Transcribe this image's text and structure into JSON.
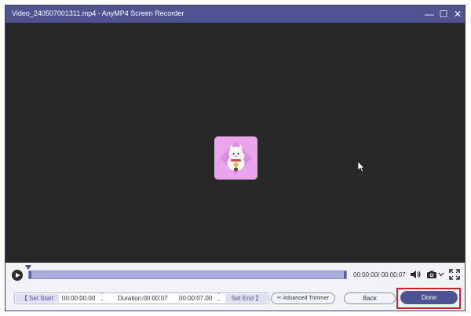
{
  "window": {
    "title": "Video_240507001311.mp4  -  AnyMP4 Screen Recorder",
    "minimize_glyph": "—",
    "maximize_glyph": "☐",
    "close_glyph": "✕"
  },
  "player": {
    "time_display": "00:00:00/ 00:00:07",
    "playback_progress": 0.0
  },
  "trim": {
    "set_start_label": "Set Start",
    "start_time": "00:00:00.00",
    "duration_text": "Duration:00:00:07",
    "end_time": "00:00:07.00",
    "set_end_label": "Set End",
    "advanced_trimmer_label": "Advanced Trimmer"
  },
  "buttons": {
    "back_label": "Back",
    "done_label": "Done"
  },
  "colors": {
    "titlebar": "#4f5491",
    "accent": "#4d5293",
    "highlight_outline": "#d31f26"
  },
  "icons": [
    "play-icon",
    "volume-icon",
    "camera-icon",
    "chevron-down-icon",
    "fullscreen-icon",
    "scissors-icon",
    "cat-thumbnail-icon"
  ]
}
